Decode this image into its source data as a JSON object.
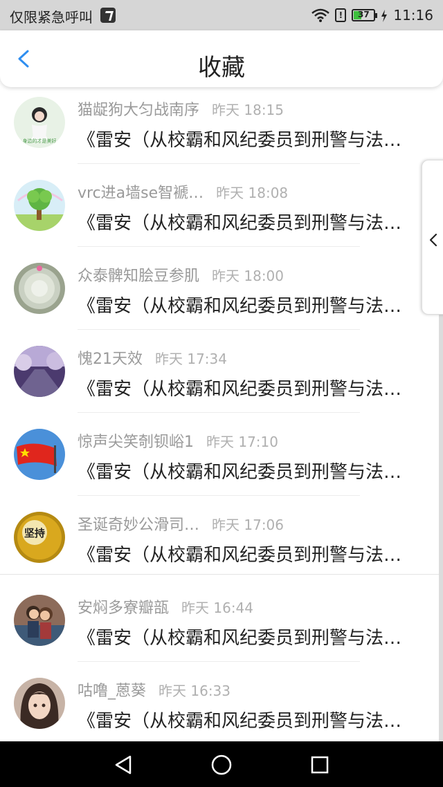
{
  "status_bar": {
    "carrier": "仅限紧急呼叫",
    "time": "11:16",
    "battery": "37"
  },
  "header": {
    "title": "收藏"
  },
  "items": [
    {
      "name": "猫龊狗大匀战南序",
      "time": "昨天 18:15",
      "content": "《雷安（从校霸和风纪委员到刑警与法…"
    },
    {
      "name": "vrc进a墙se智褫…",
      "time": "昨天 18:08",
      "content": "《雷安（从校霸和风纪委员到刑警与法…"
    },
    {
      "name": "众泰髀知脍豆参肌",
      "time": "昨天 18:00",
      "content": "《雷安（从校霸和风纪委员到刑警与法…"
    },
    {
      "name": "愧21天效",
      "time": "昨天 17:34",
      "content": "《雷安（从校霸和风纪委员到刑警与法…"
    },
    {
      "name": "惊声尖笑剞钡峪1",
      "time": "昨天 17:10",
      "content": "《雷安（从校霸和风纪委员到刑警与法…"
    },
    {
      "name": "圣诞奇妙公滑司…",
      "time": "昨天 17:06",
      "content": "《雷安（从校霸和风纪委员到刑警与法…"
    },
    {
      "name": "安焖多寮瓣瓿",
      "time": "昨天 16:44",
      "content": "《雷安（从校霸和风纪委员到刑警与法…"
    },
    {
      "name": "咕噜_蒽葵",
      "time": "昨天 16:33",
      "content": "《雷安（从校霸和风纪委员到刑警与法…"
    }
  ],
  "avatar_texts": {
    "item5": "坚持",
    "item0": "身边的才是美好"
  },
  "colors": {
    "accent": "#2f8ef0",
    "statusbar": "#d6d6d6",
    "navbar": "#000000"
  },
  "icons": {
    "back": "chevron-left-icon",
    "side": "chevron-left-icon",
    "nav": [
      "back-triangle-icon",
      "home-circle-icon",
      "recents-square-icon"
    ]
  }
}
